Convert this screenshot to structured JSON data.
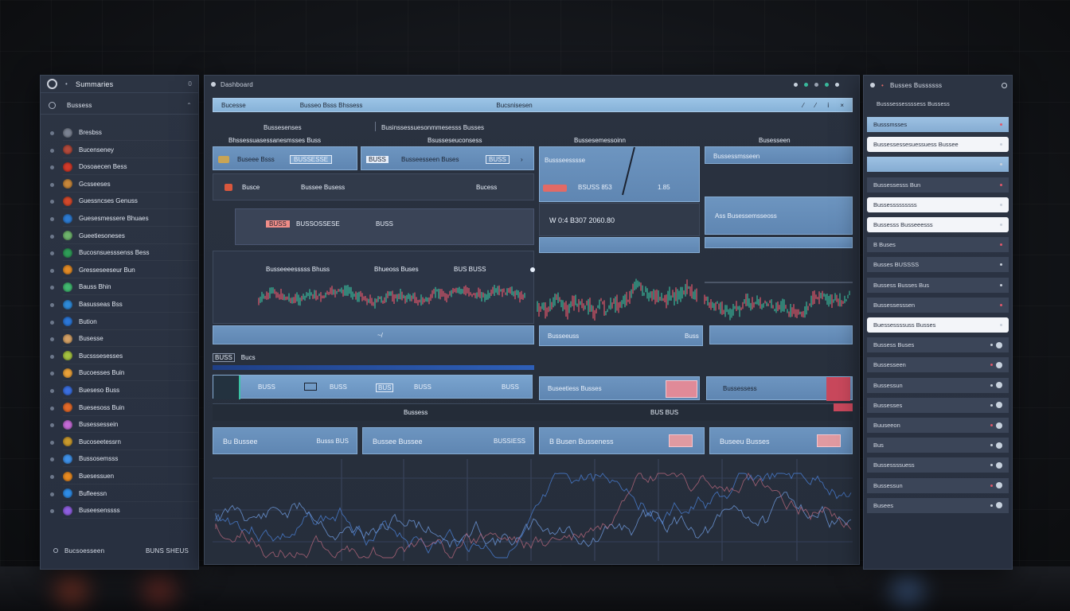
{
  "colors": {
    "accent_blue": "#86b2d8",
    "panel": "#2b3342",
    "up": "#39b89b",
    "down": "#e0576a",
    "line": "#4a7fd6"
  },
  "left_panel": {
    "title": "Summaries",
    "header_count": "0",
    "sub_label": "Bussess",
    "items": [
      {
        "label": "Bresbss",
        "color": "#7b8392"
      },
      {
        "label": "Bucenseney",
        "color": "#b24a3c"
      },
      {
        "label": "Dosoaecen Bess",
        "color": "#d23a2a"
      },
      {
        "label": "Gcsseeses",
        "color": "#c7873b"
      },
      {
        "label": "Guessncses Genuss",
        "color": "#d3492c"
      },
      {
        "label": "Guesesmessere Bhuaes",
        "color": "#2d7bd2"
      },
      {
        "label": "Gueetiesoneses",
        "color": "#6fb46d"
      },
      {
        "label": "Bucosnsuesssenss Bess",
        "color": "#2f9c58"
      },
      {
        "label": "Gresseseeseur Bun",
        "color": "#e28b27"
      },
      {
        "label": "Bauss Bhin",
        "color": "#42b870"
      },
      {
        "label": "Basusseas Bss",
        "color": "#2f8ad8"
      },
      {
        "label": "Bution",
        "color": "#2c77d8"
      },
      {
        "label": "Busesse",
        "color": "#d4a166"
      },
      {
        "label": "Bucsssesesses",
        "color": "#a4c241"
      },
      {
        "label": "Bucoesses Buin",
        "color": "#e9a13a"
      },
      {
        "label": "Bueseso Buss",
        "color": "#3b6fe0"
      },
      {
        "label": "Buesesoss Buin",
        "color": "#e36a2a"
      },
      {
        "label": "Busessessein",
        "color": "#c46bd6"
      },
      {
        "label": "Bucoseetessrn",
        "color": "#c99a2e"
      },
      {
        "label": "Bussosemsss",
        "color": "#3f91e8"
      },
      {
        "label": "Buesessuen",
        "color": "#e78a22"
      },
      {
        "label": "Bufleessn",
        "color": "#2f8ce6"
      },
      {
        "label": "Buseesenssss",
        "color": "#8f5fe0"
      }
    ],
    "footer_left": "Bucsoesseen",
    "footer_right": "BUNS SHEUS"
  },
  "main": {
    "tab_label": "Dashboard",
    "search_placeholder": "Bucesse",
    "search_path": "Busseo Bsss Bhssess",
    "search_center": "Bucsnisesen",
    "section_a": "Bussesenses",
    "section_b": "Businssessuesonmmesesss Busses",
    "col_headers": [
      "Bhssessuasessanesmsses Buss",
      "Bsusseseuconsess",
      "Bussesemessoinn",
      "Busesseen"
    ],
    "card1_title": "Buseee Bsss",
    "card1_badge": "BUSSESSE",
    "card2_badge": "BUSS",
    "card2_title": "Busseesseen Buses",
    "card2_value": "BUSS",
    "card3_line": "Bussseesssse",
    "card3_values": [
      "BSUSS 853",
      "1.85"
    ],
    "card4_title": "Bussessmsseen",
    "row2_left": "Busce",
    "row2_mid": "Bussee Busess",
    "row2_right": "Bucess",
    "row3_badge": "BUSS",
    "row3_text": "BUSSOSSESE",
    "row3_val": "BUSS",
    "row3_mid": "W 0:4   B307   2060.80",
    "row3_right": "Ass Busessemsseoss",
    "chart_header": [
      "Busseeeesssss Bhuss",
      "Bhueoss Buses",
      "BUS BUSS"
    ],
    "bottom_strip_labels": [
      "Busseeuss",
      "Buss"
    ],
    "tile_row_labels": [
      "BUSS",
      "BUSSE",
      "Bucs"
    ],
    "tile_blue_a": [
      "BUSS",
      "BUSS",
      "BUS",
      "BUSS"
    ],
    "tile_val_a": "BUSS",
    "tile_right_a": "Buseetiess Busses",
    "tile_right_b": "Bussessess",
    "strip_center": "Bussess",
    "strip_right": "BUS BUS",
    "cards_bottom": [
      {
        "left": "Bu Bussee",
        "right": "Busss BUS"
      },
      {
        "left": "Bussee Bussee",
        "right": "BUSSIESS"
      },
      {
        "left": "B   Busen Busseness",
        "right": ""
      },
      {
        "left": "Buseeu Busses",
        "right": ""
      }
    ]
  },
  "right_panel": {
    "title": "Busses Bussssss",
    "subtitle": "Busssessessssess Bussess",
    "rows": [
      {
        "text": "Busssmsses",
        "style": "blue"
      },
      {
        "text": "Bussessessesuessuess Bussee",
        "style": "white"
      },
      {
        "text": "",
        "style": "blue"
      },
      {
        "text": "Bussessesss Bun",
        "style": "mid"
      },
      {
        "text": "Bussesssssssss",
        "style": "white"
      },
      {
        "text": "Bussesss Busseeesss",
        "style": "white"
      },
      {
        "text": "B Buses",
        "style": "mid"
      },
      {
        "text": "Busses BUSSSS",
        "style": "mid"
      },
      {
        "text": "Bussess Busses Bus",
        "style": "mid"
      },
      {
        "text": "Bussessesssen",
        "style": "mid"
      },
      {
        "text": "Buessessssuss Busses",
        "style": "white"
      },
      {
        "text": "Bussess Buses",
        "style": "mid"
      },
      {
        "text": "Bussesseen",
        "style": "mid"
      },
      {
        "text": "Bussessun",
        "style": "mid"
      },
      {
        "text": "Bussesses",
        "style": "mid"
      },
      {
        "text": "Buuseeon",
        "style": "mid"
      },
      {
        "text": "Bus",
        "style": "mid"
      },
      {
        "text": "Bussessssuess",
        "style": "mid"
      },
      {
        "text": "Bussessun",
        "style": "mid"
      },
      {
        "text": "Busees",
        "style": "mid"
      }
    ],
    "row_values": [
      "B BUSS",
      "BUSS",
      "BUSS"
    ]
  }
}
